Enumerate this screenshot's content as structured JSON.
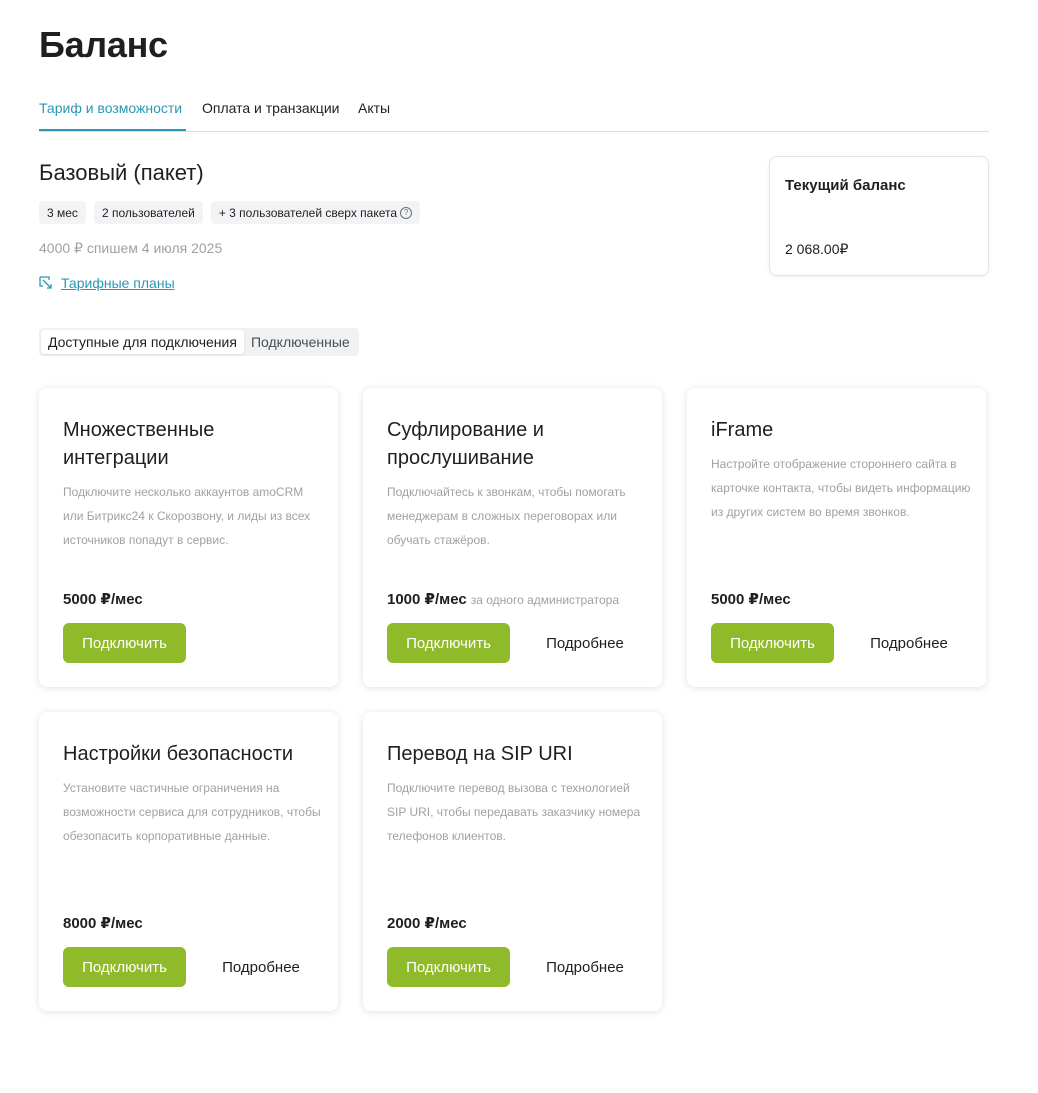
{
  "page": {
    "title": "Баланс"
  },
  "tabs": [
    {
      "label": "Тариф и возможности",
      "active": true
    },
    {
      "label": "Оплата и транзакции",
      "active": false
    },
    {
      "label": "Акты",
      "active": false
    }
  ],
  "plan": {
    "title": "Базовый (пакет)",
    "chips": [
      "3 мес",
      "2 пользователей",
      "+ 3 пользователей сверх пакета"
    ],
    "charge_note": "4000 ₽ спишем 4 июля 2025",
    "plans_link": "Тарифные планы"
  },
  "balance": {
    "title": "Текущий баланс",
    "value": "2 068.00₽"
  },
  "segments": [
    {
      "label": "Доступные для подключения",
      "active": true
    },
    {
      "label": "Подключенные",
      "active": false
    }
  ],
  "cards": [
    {
      "title": "Множественные интеграции",
      "description": "Подключите несколько аккаунтов amoCRM или Битрикс24 к Скорозвону, и лиды из всех источников попадут в сервис.",
      "price": "5000 ₽/мес",
      "price_note": "",
      "connect_label": "Подключить",
      "more_label": ""
    },
    {
      "title": "Суфлирование и прослушивание",
      "description": "Подключайтесь к звонкам, чтобы помогать менеджерам в сложных переговорах или обучать стажёров.",
      "price": "1000 ₽/мес",
      "price_note": "за одного администратора",
      "connect_label": "Подключить",
      "more_label": "Подробнее"
    },
    {
      "title": "iFrame",
      "description": "Настройте отображение стороннего сайта в карточке контакта, чтобы видеть информацию из других систем во время звонков.",
      "price": "5000 ₽/мес",
      "price_note": "",
      "connect_label": "Подключить",
      "more_label": "Подробнее"
    },
    {
      "title": "Настройки безопасности",
      "description": "Установите частичные ограничения на возможности сервиса для сотрудников, чтобы обезопасить корпоративные данные.",
      "price": "8000 ₽/мес",
      "price_note": "",
      "connect_label": "Подключить",
      "more_label": "Подробнее"
    },
    {
      "title": "Перевод на SIP URI",
      "description": "Подключите перевод вызова с технологией SIP URI, чтобы передавать заказчику номера телефонов клиентов.",
      "price": "2000 ₽/мес",
      "price_note": "",
      "connect_label": "Подключить",
      "more_label": "Подробнее"
    }
  ],
  "colors": {
    "accent": "#2b97b5",
    "primary_button": "#8fbb2b",
    "muted_text": "#9ea1a6"
  }
}
